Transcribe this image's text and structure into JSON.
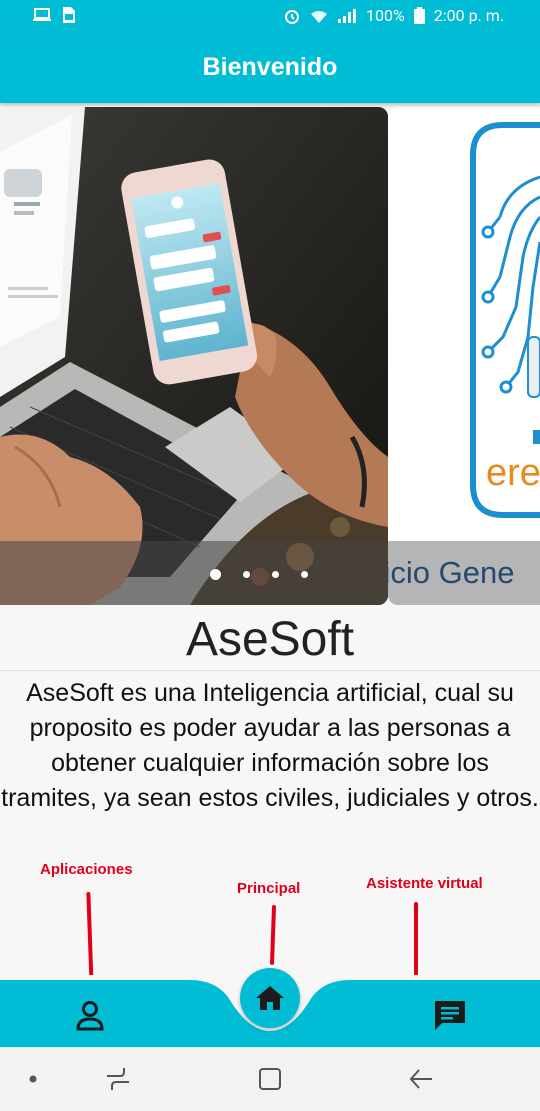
{
  "status_bar": {
    "battery": "100%",
    "time": "2:00 p. m."
  },
  "app_bar": {
    "title": "Bienvenido"
  },
  "carousel": {
    "slide2_caption": "vicio Gene",
    "slide2_logo_fragment": "ere",
    "dot_count": 4,
    "active_dot": 0
  },
  "main": {
    "title": "AseSoft",
    "description": "AseSoft es una Inteligencia artificial, cual su proposito es poder ayudar a las personas a obtener cualquier información sobre los tramites, ya sean estos civiles, judiciales y otros."
  },
  "annotations": {
    "apps": "Aplicaciones",
    "home": "Principal",
    "assistant": "Asistente virtual"
  },
  "nav": {
    "left_icon": "person-icon",
    "center_icon": "home-icon",
    "right_icon": "chat-icon"
  },
  "colors": {
    "primary": "#00bcd4",
    "annotation": "#e0001a"
  }
}
